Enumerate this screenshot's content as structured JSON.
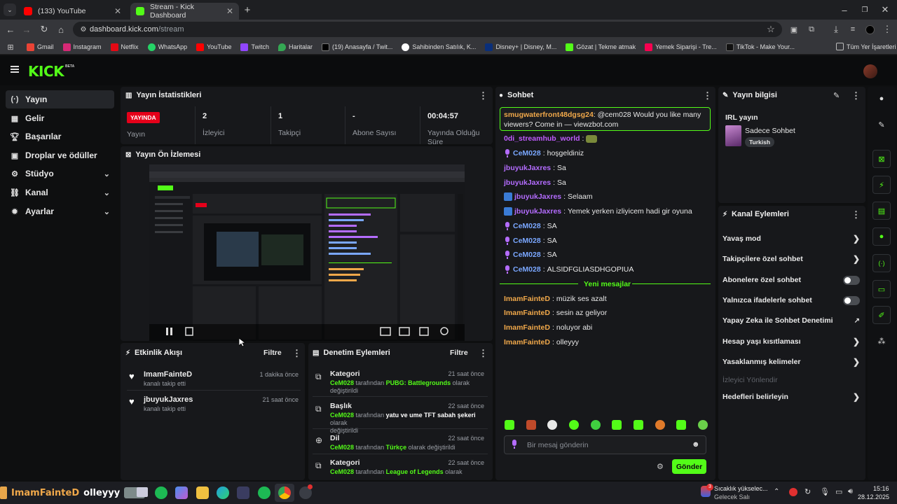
{
  "browser": {
    "tabs": [
      {
        "title": "(133) YouTube"
      },
      {
        "title": "Stream - Kick Dashboard"
      }
    ],
    "url_host": "dashboard.kick.com",
    "url_path": "/stream",
    "bookmarks": [
      "Gmail",
      "Instagram",
      "Netflix",
      "WhatsApp",
      "YouTube",
      "Twitch",
      "Haritalar",
      "(19) Anasayfa / Twit...",
      "Sahibinden Satılık, K...",
      "Disney+ | Disney, M...",
      "Gözat | Tekme atmak",
      "Yemek Siparişi - Tre...",
      "TikTok - Make Your..."
    ],
    "all_bookmarks": "Tüm Yer İşaretleri"
  },
  "kick": {
    "logo": "KICK",
    "beta": "BETA",
    "accent": "#53fc18"
  },
  "sidebar": {
    "items": [
      {
        "label": "Yayın",
        "icon": "broadcast-icon"
      },
      {
        "label": "Gelir",
        "icon": "revenue-icon"
      },
      {
        "label": "Başarılar",
        "icon": "trophy-icon"
      },
      {
        "label": "Droplar ve ödüller",
        "icon": "gift-icon"
      },
      {
        "label": "Stüdyo",
        "icon": "studio-icon"
      },
      {
        "label": "Kanal",
        "icon": "channel-icon"
      },
      {
        "label": "Ayarlar",
        "icon": "gear-icon"
      }
    ]
  },
  "stats": {
    "title": "Yayın İstatistikleri",
    "live_badge": "YAYINDA",
    "live_label": "Yayın",
    "viewers_value": "2",
    "viewers_label": "İzleyici",
    "followers_value": "1",
    "followers_label": "Takipçi",
    "subs_value": "-",
    "subs_label": "Abone Sayısı",
    "duration_value": "00:04:57",
    "duration_label": "Yayında Olduğu Süre"
  },
  "preview": {
    "title": "Yayın Ön İzlemesi"
  },
  "activity": {
    "title": "Etkinlik Akışı",
    "filter": "Filtre",
    "items": [
      {
        "name": "ImamFainteD",
        "sub": "kanalı takip etti",
        "time": "1 dakika önce"
      },
      {
        "name": "jbuyukJaxres",
        "sub": "kanalı takip etti",
        "time": "21 saat önce"
      }
    ]
  },
  "moderation": {
    "title": "Denetim Eylemleri",
    "filter": "Filtre",
    "items": [
      {
        "title": "Kategori",
        "time": "21 saat önce",
        "user": "CeM028",
        "mid": "tarafından",
        "value": "PUBG: Battlegrounds",
        "tail": "olarak",
        "line2": "değiştirildi"
      },
      {
        "title": "Başlık",
        "time": "22 saat önce",
        "user": "CeM028",
        "mid": "tarafından",
        "value": "yatu ve ume TFT sabah şekeri",
        "tail": "olarak",
        "line2": "değiştirildi"
      },
      {
        "title": "Dil",
        "time": "22 saat önce",
        "user": "CeM028",
        "mid": "tarafından",
        "value": "Türkçe",
        "tail": "olarak değiştirildi",
        "line2": ""
      },
      {
        "title": "Kategori",
        "time": "22 saat önce",
        "user": "CeM028",
        "mid": "tarafından",
        "value": "League of Legends",
        "tail": "olarak",
        "line2": ""
      }
    ]
  },
  "chat": {
    "title": "Sohbet",
    "pinned_user": "smugwaterfront48dgsg24",
    "pinned_text": "@cem028 Would you like many viewers? Come in — viewzbot.com",
    "messages": [
      {
        "user": "0di_streamhub_world",
        "text": "",
        "color": "purple",
        "badge": "none"
      },
      {
        "user": "CeM028",
        "text": "hoşgeldiniz",
        "color": "blue",
        "badge": "mic"
      },
      {
        "user": "jbuyukJaxres",
        "text": "Sa",
        "color": "purple",
        "badge": "none"
      },
      {
        "user": "jbuyukJaxres",
        "text": "Sa",
        "color": "purple",
        "badge": "none"
      },
      {
        "user": "jbuyukJaxres",
        "text": "Selaam",
        "color": "purple",
        "badge": "box"
      },
      {
        "user": "jbuyukJaxres",
        "text": "Yemek yerken izliyicem hadi gir oyuna",
        "color": "purple",
        "badge": "box"
      },
      {
        "user": "CeM028",
        "text": "SA",
        "color": "blue",
        "badge": "mic"
      },
      {
        "user": "CeM028",
        "text": "SA",
        "color": "blue",
        "badge": "mic"
      },
      {
        "user": "CeM028",
        "text": "SA",
        "color": "blue",
        "badge": "mic"
      },
      {
        "user": "CeM028",
        "text": "ALSIDFGLIASDHGOPIUA",
        "color": "blue",
        "badge": "mic"
      }
    ],
    "new_messages": "Yeni mesajlar",
    "new": [
      {
        "user": "ImamFainteD",
        "text": "müzik ses azalt"
      },
      {
        "user": "ImamFainteD",
        "text": "sesin az geliyor"
      },
      {
        "user": "ImamFainteD",
        "text": "noluyor abi"
      },
      {
        "user": "ImamFainteD",
        "text": "olleyyy"
      }
    ],
    "input_placeholder": "Bir mesaj gönderin",
    "send": "Gönder"
  },
  "stream_info": {
    "title": "Yayın bilgisi",
    "stream_title": "IRL yayın",
    "category": "Sadece Sohbet",
    "tag": "Turkish"
  },
  "channel_actions": {
    "title": "Kanal Eylemleri",
    "items": [
      {
        "label": "Yavaş mod",
        "type": "arrow"
      },
      {
        "label": "Takipçilere özel sohbet",
        "type": "arrow"
      },
      {
        "label": "Abonelere özel sohbet",
        "type": "toggle"
      },
      {
        "label": "Yalnızca ifadelerle sohbet",
        "type": "toggle"
      },
      {
        "label": "Yapay Zeka ile Sohbet Denetimi",
        "type": "external"
      },
      {
        "label": "Hesap yaşı kısıtlaması",
        "type": "arrow"
      },
      {
        "label": "Yasaklanmış kelimeler",
        "type": "arrow"
      },
      {
        "label": "İzleyici Yönlendir",
        "type": "disabled"
      },
      {
        "label": "Hedefleri belirleyin",
        "type": "arrow"
      }
    ]
  },
  "taskbar": {
    "overlay_user": "ImamFainteD",
    "overlay_msg": "olleyyy",
    "weather": "Sıcaklık yükselec...",
    "weather_sub": "Gelecek Salı",
    "time": "15:16",
    "date": "28.12.2025",
    "notif_count": "3"
  }
}
